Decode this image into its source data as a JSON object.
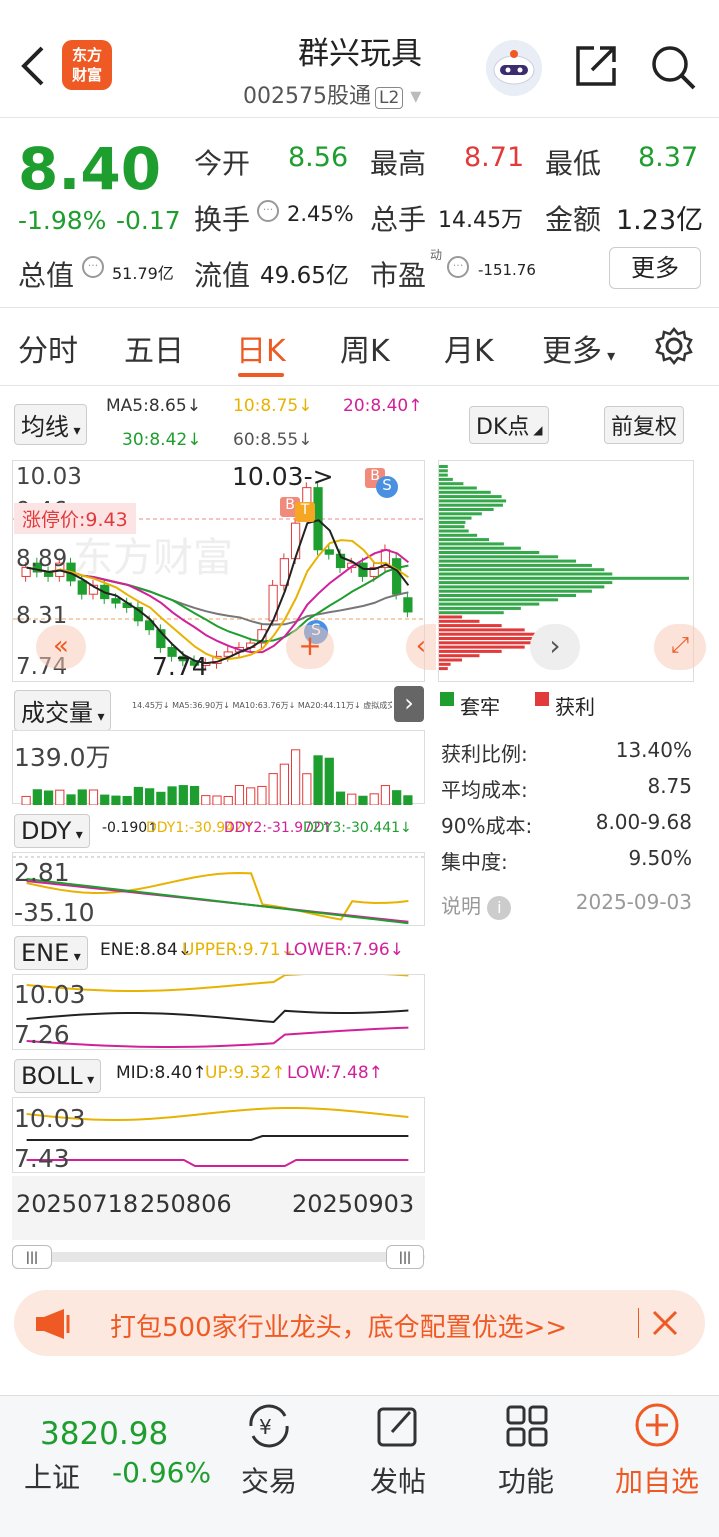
{
  "header": {
    "title": "群兴玩具",
    "code": "002575",
    "connect": "股通",
    "level": "L2",
    "logo_line1": "东方",
    "logo_line2": "财富"
  },
  "quote": {
    "price": "8.40",
    "pct": "-1.98%",
    "chg": "-0.17",
    "open_label": "今开",
    "open": "8.56",
    "high_label": "最高",
    "high": "8.71",
    "low_label": "最低",
    "low": "8.37",
    "turnover_label": "换手",
    "turnover": "2.45%",
    "volume_label": "总手",
    "volume": "14.45万",
    "amount_label": "金额",
    "amount": "1.23亿",
    "mcap_label": "总值",
    "mcap": "51.79亿",
    "float_label": "流值",
    "float": "49.65亿",
    "pe_label": "市盈",
    "pe_sup": "动",
    "pe": "-151.76",
    "more": "更多"
  },
  "tabs": [
    "分时",
    "五日",
    "日K",
    "周K",
    "月K",
    "更多"
  ],
  "kline": {
    "ma_btn": "均线",
    "ma5": "MA5:8.65↓",
    "ma10": "10:8.75↓",
    "ma20": "20:8.40↑",
    "ma30": "30:8.42↓",
    "ma60": "60:8.55↓",
    "dk_btn": "DK点",
    "fq_btn": "前复权",
    "y_top": "10.03",
    "y_mid": "9.46",
    "y_mid2": "8.89",
    "y_mid3": "8.31",
    "y_bot": "7.74",
    "limit": "涨停价:9.43",
    "hi_mark": "10.03->",
    "lo_mark": "7.74",
    "watermark": "东方财富"
  },
  "volume": {
    "btn": "成交量",
    "legend": "14.45万↓ MA5:36.90万↓ MA10:63.76万↓ MA20:44.11万↓ 虚拟成交量25.75万",
    "y_top": "139.0万"
  },
  "ddy": {
    "btn": "DDY",
    "v": "-0.190↑",
    "ddy1": "DDY1:-30.942↑",
    "ddy2": "DDY2:-31.972↑",
    "ddy3": "DDY3:-30.441↓",
    "y_top": "2.81",
    "y_bot": "-35.10"
  },
  "ene": {
    "btn": "ENE",
    "ene": "ENE:8.84↓",
    "upper": "UPPER:9.71↓",
    "lower": "LOWER:7.96↓",
    "y_top": "10.03",
    "y_bot": "7.26"
  },
  "boll": {
    "btn": "BOLL",
    "mid": "MID:8.40↑",
    "up": "UP:9.32↑",
    "low": "LOW:7.48↑",
    "y_top": "10.03",
    "y_bot": "7.43"
  },
  "dates": [
    "20250718",
    "250806",
    "20250903"
  ],
  "chip": {
    "legend1": "套牢",
    "legend2": "获利",
    "rows": [
      [
        "获利比例:",
        "13.40%"
      ],
      [
        "平均成本:",
        "8.75"
      ],
      [
        "90%成本:",
        "8.00-9.68"
      ],
      [
        "集中度:",
        "9.50%"
      ]
    ],
    "note": "说明",
    "date": "2025-09-03"
  },
  "banner": {
    "text": "打包500家行业龙头，底仓配置优选>>"
  },
  "bottom": {
    "index_value": "3820.98",
    "index_name": "上证",
    "index_pct": "-0.96%",
    "items": [
      "交易",
      "发帖",
      "功能",
      "加自选"
    ]
  },
  "colors": {
    "up": "#e23a3a",
    "down": "#1e9e2e",
    "accent": "#ef5a24"
  }
}
